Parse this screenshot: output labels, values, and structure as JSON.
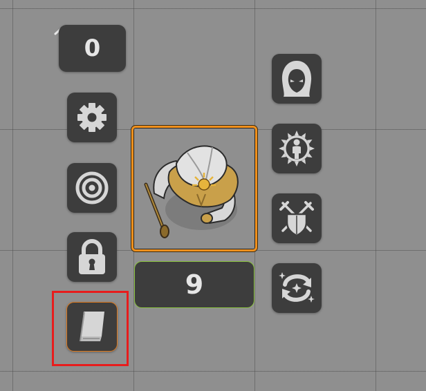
{
  "left_toolbar": {
    "counter_value": "0",
    "buttons": [
      {
        "icon": "gear-icon"
      },
      {
        "icon": "target-icon"
      },
      {
        "icon": "padlock-icon"
      },
      {
        "icon": "book-icon",
        "selected": true
      }
    ]
  },
  "right_toolbar": {
    "buttons": [
      {
        "icon": "hooded-figure-icon"
      },
      {
        "icon": "radiant-figure-icon"
      },
      {
        "icon": "crossed-swords-shield-icon"
      },
      {
        "icon": "swirl-stars-icon"
      }
    ]
  },
  "token": {
    "icon": "armored-cleric-with-mace",
    "value": "9"
  },
  "colors": {
    "tile_bg": "#3d3d3d",
    "icon_fill": "#d6d6d6",
    "token_border": "#f0901c",
    "value_border": "#8cc63f",
    "selection_highlight": "#e81c1c",
    "selected_button_border": "#e07b1e"
  }
}
